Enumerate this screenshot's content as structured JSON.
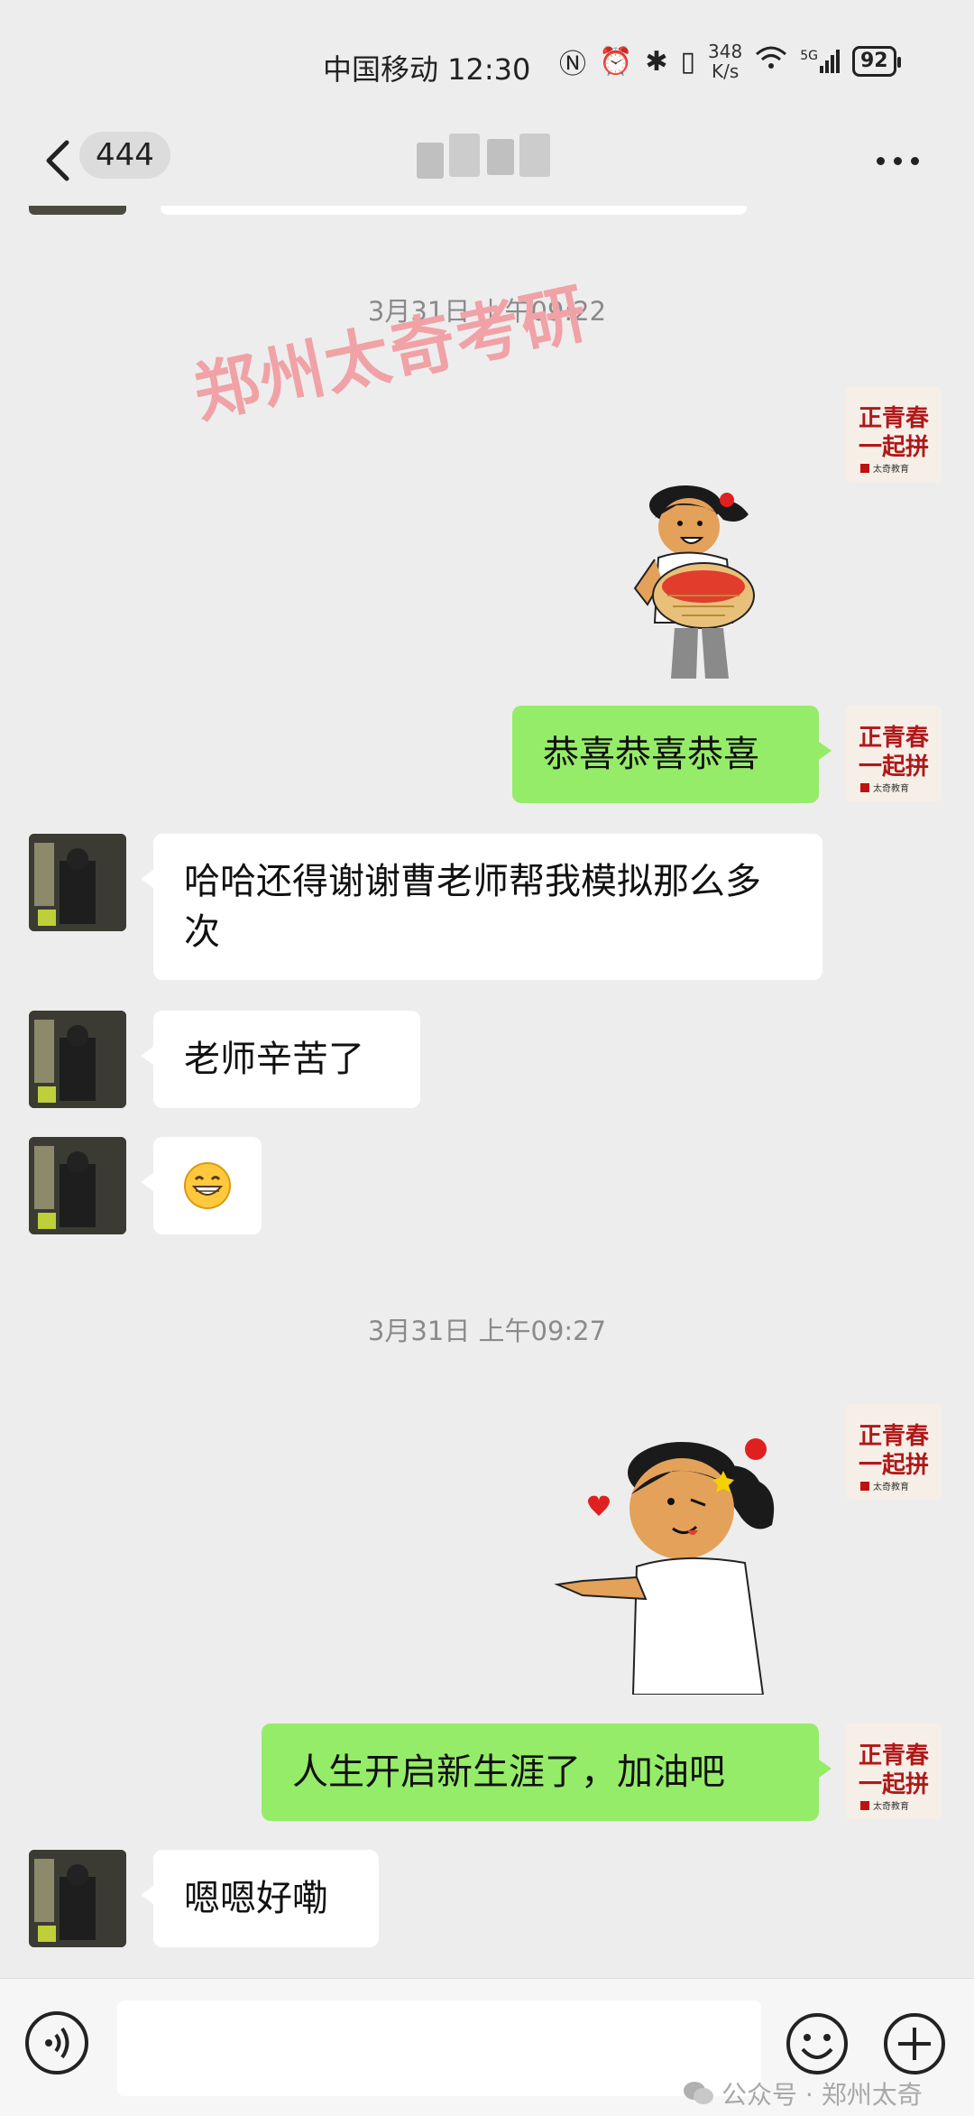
{
  "status_bar": {
    "carrier_time": "中国移动 12:30",
    "net_speed_value": "348",
    "net_speed_unit": "K/s",
    "network": "5G",
    "battery": "92"
  },
  "nav": {
    "unread_count": "444",
    "title": ""
  },
  "messages": {
    "ts1": "3月31日 上午09:22",
    "watermark": "郑州太奇考研",
    "m1": "恭喜恭喜恭喜",
    "m2": "哈哈还得谢谢曹老师帮我模拟那么多次",
    "m3": "老师辛苦了",
    "ts2": "3月31日 上午09:27",
    "m5": "人生开启新生涯了，加油吧",
    "m6": "嗯嗯好嘞"
  },
  "avatar_teacher": {
    "line1": "正青春",
    "line2": "一起拼",
    "brand": "太奇教育"
  },
  "footer": {
    "label": "公众号 · 郑州太奇"
  },
  "colors": {
    "bubble_sent": "#95ec69",
    "bubble_received": "#ffffff",
    "background": "#ededed"
  }
}
